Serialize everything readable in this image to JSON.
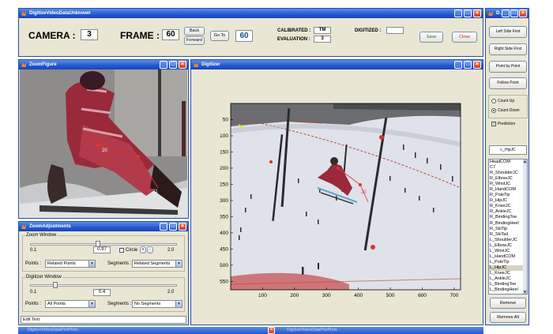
{
  "main_window": {
    "title": "DigitizeVideoDataUnknown",
    "camera_label": "CAMERA :",
    "camera_value": "3",
    "frame_label": "FRAME :",
    "frame_value": "60",
    "back_label": "Back",
    "forward_label": "Forward",
    "goto_label": "Go To",
    "goto_value": "60",
    "calibrated_label": "CALIBRATED :",
    "calibrated_value": "TM",
    "evaluation_label": "EVALUATION :",
    "evaluation_value": "3",
    "digitized_label": "DIGITIZED :",
    "digitized_value": "",
    "save_label": "Save",
    "close_label": "Close"
  },
  "side_panel": {
    "title": "D...",
    "buttons": [
      "Left Side First",
      "Right Side First",
      "Point by Point",
      "Follow Point"
    ],
    "count_up_label": "Count Up",
    "count_down_label": "Count Down",
    "count_selected": "Count Down",
    "prediction_label": "Prediction",
    "prediction_checked": true,
    "current_point": "L_HipJC",
    "points": [
      "HeadCOM",
      "C7",
      "R_ShoulderJC",
      "R_ElbowJC",
      "R_WristJC",
      "R_HandCOM",
      "R_PoleTip",
      "R_HipJC",
      "R_KneeJC",
      "R_AnkleJC",
      "R_BindingToe",
      "R_BindingHeel",
      "R_SkiTip",
      "R_SkiTail",
      "L_ShoulderJC",
      "L_ElbowJC",
      "L_WristJC",
      "L_HandCOM",
      "L_PoleTip",
      "L_HipJC",
      "L_KneeJC",
      "L_AnkleJC",
      "L_BindingToe",
      "L_BindingHeel"
    ],
    "selected_point": "L_HipJC",
    "remove_label": "Remove",
    "remove_all_label": "Remove All"
  },
  "zoom_figure": {
    "title": "ZoomFigure",
    "marker_labels": [
      "20",
      "21"
    ]
  },
  "zoom_adjustments": {
    "title": "ZoomAdjustments",
    "zoom_window_label": "Zoom Window",
    "zoom_min": "0.1",
    "zoom_value": "0.97",
    "zoom_max": "2.0",
    "zoom_slider_fraction": 0.46,
    "circle_label": "Circle",
    "plus_label": "+",
    "minus_label": "-",
    "points_label": "Points :",
    "points_select": "Related Points",
    "segments_label": "Segments :",
    "segments_select": "Related Segments",
    "digitizer_window_label": "Digitizer Window",
    "dig_min": "0.1",
    "dig_value": "0.4",
    "dig_max": "2.0",
    "dig_slider_fraction": 0.16,
    "dig_points_label": "Points :",
    "dig_points_select": "All Points",
    "dig_segments_label": "Segments :",
    "dig_segments_select": "No Segments",
    "edit_text": "Edit Text"
  },
  "digitizer": {
    "title": "Digitizer",
    "marker_label": "20"
  },
  "chart_data": {
    "type": "image-axes",
    "x_ticks": [
      "100",
      "200",
      "300",
      "400",
      "500",
      "600",
      "700"
    ],
    "y_ticks": [
      "50",
      "100",
      "150",
      "200",
      "250",
      "300",
      "350",
      "400",
      "450",
      "500",
      "550"
    ],
    "xlim": [
      0,
      720
    ],
    "ylim": [
      0,
      576
    ]
  },
  "taskbar": {
    "items": [
      "DigitizeVideoDataPlotPlots",
      "DigitizeVideoDataPlotPlots"
    ]
  },
  "colors": {
    "titlebar": "#2457cf",
    "panel": "#e9e6d4",
    "marker": "#d8342a"
  }
}
